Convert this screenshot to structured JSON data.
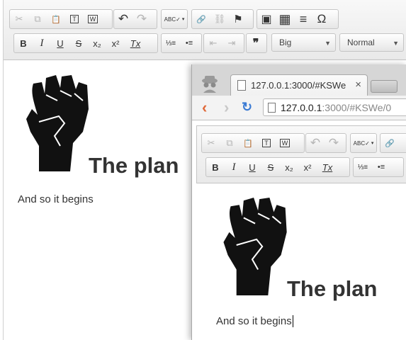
{
  "colors": {
    "accent": "#333333",
    "toolbar": "#eeeeee",
    "reload": "#3b7bd4",
    "back": "#e0693a"
  },
  "toolbar": {
    "row1": [
      {
        "icon": "cut-icon",
        "glyph": "✂",
        "disabled": true
      },
      {
        "icon": "copy-icon",
        "glyph": "⧉",
        "disabled": true
      },
      {
        "icon": "paste-icon",
        "glyph": "📋",
        "disabled": false
      },
      {
        "icon": "paste-text-icon",
        "glyph": "T",
        "disabled": false
      },
      {
        "icon": "paste-word-icon",
        "glyph": "W",
        "disabled": false
      },
      {
        "icon": "undo-icon",
        "glyph": "↶",
        "disabled": false
      },
      {
        "icon": "redo-icon",
        "glyph": "↷",
        "disabled": true
      },
      {
        "icon": "spellcheck-icon",
        "glyph": "ABC✓",
        "disabled": false
      },
      {
        "icon": "link-icon",
        "glyph": "🔗",
        "disabled": false
      },
      {
        "icon": "unlink-icon",
        "glyph": "⛓",
        "disabled": true
      },
      {
        "icon": "anchor-flag-icon",
        "glyph": "⚑",
        "disabled": false
      },
      {
        "icon": "image-icon",
        "glyph": "▣",
        "disabled": false
      },
      {
        "icon": "table-icon",
        "glyph": "▦",
        "disabled": false
      },
      {
        "icon": "horizontal-rule-icon",
        "glyph": "≡",
        "disabled": false
      },
      {
        "icon": "special-char-icon",
        "glyph": "Ω",
        "disabled": false
      }
    ],
    "row2": [
      {
        "icon": "bold-icon",
        "glyph": "B"
      },
      {
        "icon": "italic-icon",
        "glyph": "I"
      },
      {
        "icon": "underline-icon",
        "glyph": "U"
      },
      {
        "icon": "strikethrough-icon",
        "glyph": "S"
      },
      {
        "icon": "subscript-icon",
        "glyph": "x₂"
      },
      {
        "icon": "superscript-icon",
        "glyph": "x²"
      },
      {
        "icon": "remove-format-icon",
        "glyph": "Tx"
      },
      {
        "icon": "numbered-list-icon",
        "glyph": "⅓≡"
      },
      {
        "icon": "bulleted-list-icon",
        "glyph": "•≡"
      },
      {
        "icon": "outdent-icon",
        "glyph": "⇤"
      },
      {
        "icon": "indent-icon",
        "glyph": "⇥"
      },
      {
        "icon": "blockquote-icon",
        "glyph": "❞"
      }
    ],
    "size_combo": "Big",
    "format_combo": "Normal"
  },
  "document": {
    "heading": "The plan",
    "paragraph": "And so it begins"
  },
  "browser": {
    "tab_title": "127.0.0.1:3000/#KSWe",
    "tab_close": "×",
    "url_host": "127.0.0.1",
    "url_rest": ":3000/#KSWe/0",
    "heading": "The plan",
    "paragraph": "And so it begins"
  }
}
